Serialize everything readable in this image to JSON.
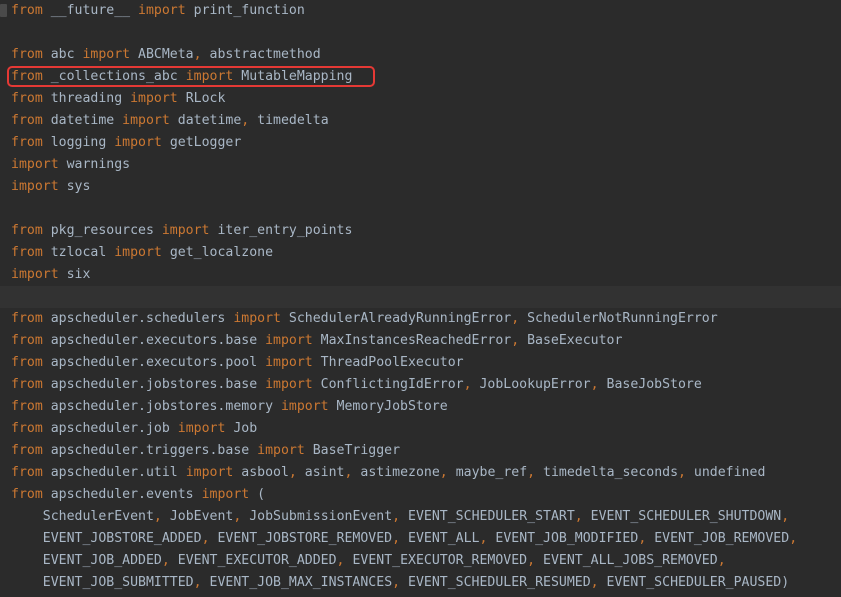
{
  "editor": {
    "language": "python",
    "colors": {
      "background": "#2b2b2b",
      "current_line": "#323232",
      "keyword": "#cc7832",
      "identifier": "#a9b7c6",
      "highlight_box": "#e53935"
    },
    "highlighted_line_index": 3,
    "current_line_index": 13,
    "lines": [
      [
        {
          "t": "kw",
          "v": "from"
        },
        {
          "t": "id",
          "v": " __future__ "
        },
        {
          "t": "kw",
          "v": "import"
        },
        {
          "t": "id",
          "v": " print_function"
        }
      ],
      [],
      [
        {
          "t": "kw",
          "v": "from"
        },
        {
          "t": "id",
          "v": " abc "
        },
        {
          "t": "kw",
          "v": "import"
        },
        {
          "t": "id",
          "v": " ABCMeta"
        },
        {
          "t": "punc",
          "v": ","
        },
        {
          "t": "id",
          "v": " abstractmethod"
        }
      ],
      [
        {
          "t": "kw",
          "v": "from"
        },
        {
          "t": "id",
          "v": " _collections_abc "
        },
        {
          "t": "kw",
          "v": "import"
        },
        {
          "t": "id",
          "v": " MutableMapping"
        }
      ],
      [
        {
          "t": "kw",
          "v": "from"
        },
        {
          "t": "id",
          "v": " threading "
        },
        {
          "t": "kw",
          "v": "import"
        },
        {
          "t": "id",
          "v": " RLock"
        }
      ],
      [
        {
          "t": "kw",
          "v": "from"
        },
        {
          "t": "id",
          "v": " datetime "
        },
        {
          "t": "kw",
          "v": "import"
        },
        {
          "t": "id",
          "v": " datetime"
        },
        {
          "t": "punc",
          "v": ","
        },
        {
          "t": "id",
          "v": " timedelta"
        }
      ],
      [
        {
          "t": "kw",
          "v": "from"
        },
        {
          "t": "id",
          "v": " logging "
        },
        {
          "t": "kw",
          "v": "import"
        },
        {
          "t": "id",
          "v": " getLogger"
        }
      ],
      [
        {
          "t": "kw",
          "v": "import"
        },
        {
          "t": "id",
          "v": " warnings"
        }
      ],
      [
        {
          "t": "kw",
          "v": "import"
        },
        {
          "t": "id",
          "v": " sys"
        }
      ],
      [],
      [
        {
          "t": "kw",
          "v": "from"
        },
        {
          "t": "id",
          "v": " pkg_resources "
        },
        {
          "t": "kw",
          "v": "import"
        },
        {
          "t": "id",
          "v": " iter_entry_points"
        }
      ],
      [
        {
          "t": "kw",
          "v": "from"
        },
        {
          "t": "id",
          "v": " tzlocal "
        },
        {
          "t": "kw",
          "v": "import"
        },
        {
          "t": "id",
          "v": " get_localzone"
        }
      ],
      [
        {
          "t": "kw",
          "v": "import"
        },
        {
          "t": "id",
          "v": " six"
        }
      ],
      [],
      [
        {
          "t": "kw",
          "v": "from"
        },
        {
          "t": "id",
          "v": " apscheduler.schedulers "
        },
        {
          "t": "kw",
          "v": "import"
        },
        {
          "t": "id",
          "v": " SchedulerAlreadyRunningError"
        },
        {
          "t": "punc",
          "v": ","
        },
        {
          "t": "id",
          "v": " SchedulerNotRunningError"
        }
      ],
      [
        {
          "t": "kw",
          "v": "from"
        },
        {
          "t": "id",
          "v": " apscheduler.executors.base "
        },
        {
          "t": "kw",
          "v": "import"
        },
        {
          "t": "id",
          "v": " MaxInstancesReachedError"
        },
        {
          "t": "punc",
          "v": ","
        },
        {
          "t": "id",
          "v": " BaseExecutor"
        }
      ],
      [
        {
          "t": "kw",
          "v": "from"
        },
        {
          "t": "id",
          "v": " apscheduler.executors.pool "
        },
        {
          "t": "kw",
          "v": "import"
        },
        {
          "t": "id",
          "v": " ThreadPoolExecutor"
        }
      ],
      [
        {
          "t": "kw",
          "v": "from"
        },
        {
          "t": "id",
          "v": " apscheduler.jobstores.base "
        },
        {
          "t": "kw",
          "v": "import"
        },
        {
          "t": "id",
          "v": " ConflictingIdError"
        },
        {
          "t": "punc",
          "v": ","
        },
        {
          "t": "id",
          "v": " JobLookupError"
        },
        {
          "t": "punc",
          "v": ","
        },
        {
          "t": "id",
          "v": " BaseJobStore"
        }
      ],
      [
        {
          "t": "kw",
          "v": "from"
        },
        {
          "t": "id",
          "v": " apscheduler.jobstores.memory "
        },
        {
          "t": "kw",
          "v": "import"
        },
        {
          "t": "id",
          "v": " MemoryJobStore"
        }
      ],
      [
        {
          "t": "kw",
          "v": "from"
        },
        {
          "t": "id",
          "v": " apscheduler.job "
        },
        {
          "t": "kw",
          "v": "import"
        },
        {
          "t": "id",
          "v": " Job"
        }
      ],
      [
        {
          "t": "kw",
          "v": "from"
        },
        {
          "t": "id",
          "v": " apscheduler.triggers.base "
        },
        {
          "t": "kw",
          "v": "import"
        },
        {
          "t": "id",
          "v": " BaseTrigger"
        }
      ],
      [
        {
          "t": "kw",
          "v": "from"
        },
        {
          "t": "id",
          "v": " apscheduler.util "
        },
        {
          "t": "kw",
          "v": "import"
        },
        {
          "t": "id",
          "v": " asbool"
        },
        {
          "t": "punc",
          "v": ","
        },
        {
          "t": "id",
          "v": " asint"
        },
        {
          "t": "punc",
          "v": ","
        },
        {
          "t": "id",
          "v": " astimezone"
        },
        {
          "t": "punc",
          "v": ","
        },
        {
          "t": "id",
          "v": " maybe_ref"
        },
        {
          "t": "punc",
          "v": ","
        },
        {
          "t": "id",
          "v": " timedelta_seconds"
        },
        {
          "t": "punc",
          "v": ","
        },
        {
          "t": "id",
          "v": " undefined"
        }
      ],
      [
        {
          "t": "kw",
          "v": "from"
        },
        {
          "t": "id",
          "v": " apscheduler.events "
        },
        {
          "t": "kw",
          "v": "import"
        },
        {
          "t": "id",
          "v": " ("
        }
      ],
      [
        {
          "t": "id",
          "v": "    SchedulerEvent"
        },
        {
          "t": "punc",
          "v": ","
        },
        {
          "t": "id",
          "v": " JobEvent"
        },
        {
          "t": "punc",
          "v": ","
        },
        {
          "t": "id",
          "v": " JobSubmissionEvent"
        },
        {
          "t": "punc",
          "v": ","
        },
        {
          "t": "id",
          "v": " EVENT_SCHEDULER_START"
        },
        {
          "t": "punc",
          "v": ","
        },
        {
          "t": "id",
          "v": " EVENT_SCHEDULER_SHUTDOWN"
        },
        {
          "t": "punc",
          "v": ","
        }
      ],
      [
        {
          "t": "id",
          "v": "    EVENT_JOBSTORE_ADDED"
        },
        {
          "t": "punc",
          "v": ","
        },
        {
          "t": "id",
          "v": " EVENT_JOBSTORE_REMOVED"
        },
        {
          "t": "punc",
          "v": ","
        },
        {
          "t": "id",
          "v": " EVENT_ALL"
        },
        {
          "t": "punc",
          "v": ","
        },
        {
          "t": "id",
          "v": " EVENT_JOB_MODIFIED"
        },
        {
          "t": "punc",
          "v": ","
        },
        {
          "t": "id",
          "v": " EVENT_JOB_REMOVED"
        },
        {
          "t": "punc",
          "v": ","
        }
      ],
      [
        {
          "t": "id",
          "v": "    EVENT_JOB_ADDED"
        },
        {
          "t": "punc",
          "v": ","
        },
        {
          "t": "id",
          "v": " EVENT_EXECUTOR_ADDED"
        },
        {
          "t": "punc",
          "v": ","
        },
        {
          "t": "id",
          "v": " EVENT_EXECUTOR_REMOVED"
        },
        {
          "t": "punc",
          "v": ","
        },
        {
          "t": "id",
          "v": " EVENT_ALL_JOBS_REMOVED"
        },
        {
          "t": "punc",
          "v": ","
        }
      ],
      [
        {
          "t": "id",
          "v": "    EVENT_JOB_SUBMITTED"
        },
        {
          "t": "punc",
          "v": ","
        },
        {
          "t": "id",
          "v": " EVENT_JOB_MAX_INSTANCES"
        },
        {
          "t": "punc",
          "v": ","
        },
        {
          "t": "id",
          "v": " EVENT_SCHEDULER_RESUMED"
        },
        {
          "t": "punc",
          "v": ","
        },
        {
          "t": "id",
          "v": " EVENT_SCHEDULER_PAUSED)"
        }
      ]
    ]
  }
}
